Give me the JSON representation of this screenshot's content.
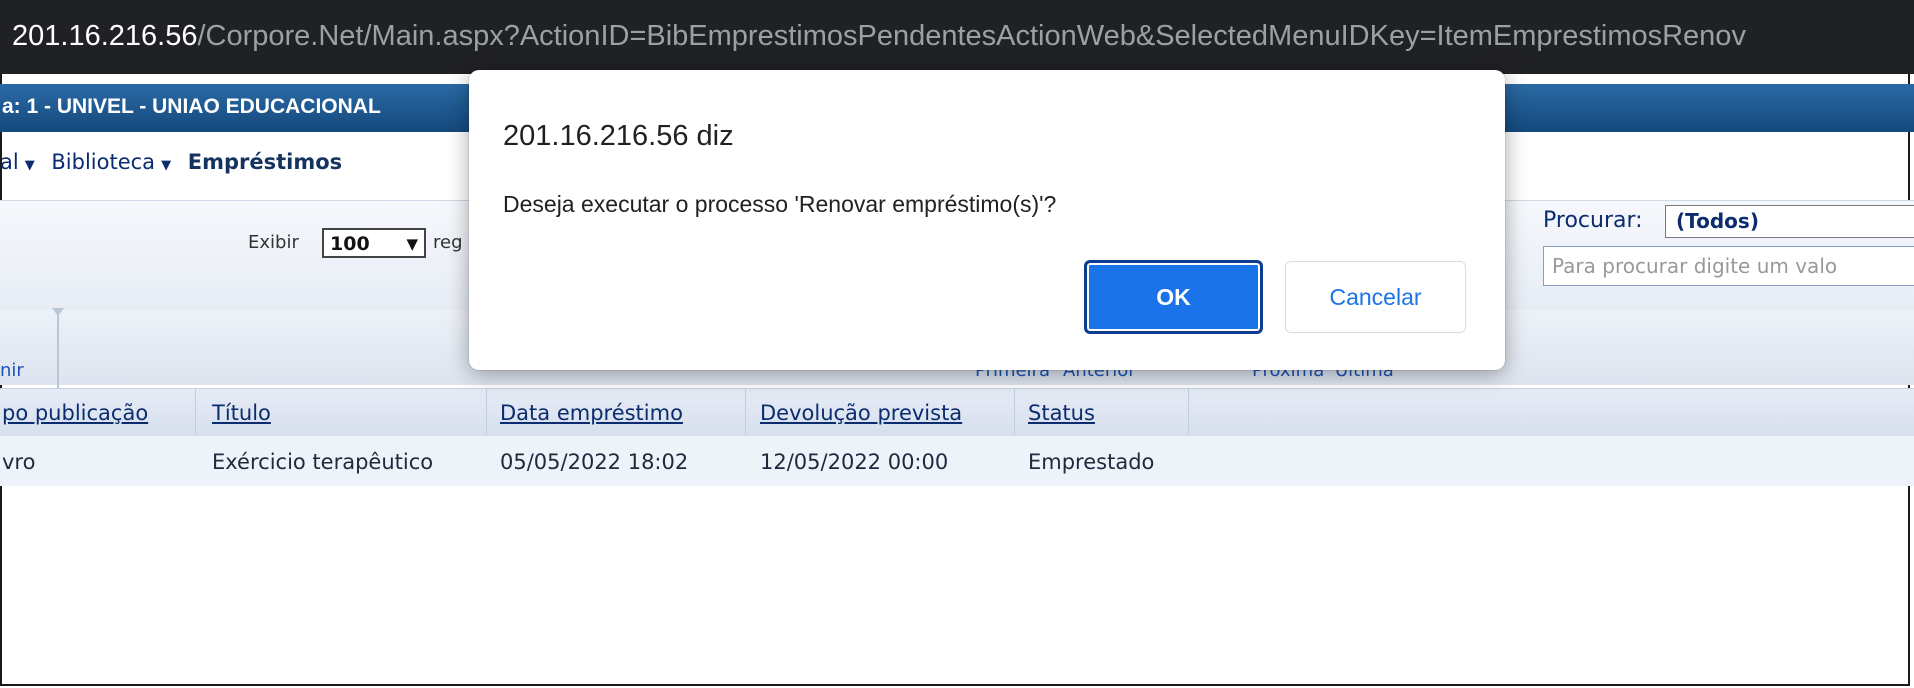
{
  "browser": {
    "url_host": "201.16.216.56",
    "url_path": "/Corpore.Net/Main.aspx?ActionID=BibEmprestimosPendentesActionWeb&SelectedMenuIDKey=ItemEmprestimosRenov"
  },
  "titlebar": {
    "text": "a: 1 - UNIVEL - UNIAO EDUCACIONAL"
  },
  "breadcrumb": {
    "item1": "al",
    "item2": "Biblioteca",
    "current": "Empréstimos"
  },
  "toolbar": {
    "exibir_label": "Exibir",
    "exibir_value": "100",
    "registros_label": "reg",
    "procurar_label": "Procurar:",
    "procurar_value": "(Todos)",
    "search_placeholder": "Para procurar digite um valo"
  },
  "nav": {
    "imprimir": "nir",
    "primeira": "Primeira",
    "anterior": "Anterior",
    "proxima": "Próxima",
    "ultima": "Última"
  },
  "table": {
    "headers": [
      "po publicação",
      "Título",
      "Data empréstimo",
      "Devolução prevista",
      "Status"
    ],
    "rows": [
      [
        "vro",
        "Exércicio terapêutico",
        "05/05/2022 18:02",
        "12/05/2022 00:00",
        "Emprestado"
      ]
    ]
  },
  "dialog": {
    "title": "201.16.216.56 diz",
    "message": "Deseja executar o processo 'Renovar empréstimo(s)'?",
    "ok_label": "OK",
    "cancel_label": "Cancelar"
  },
  "colors": {
    "accent": "#1a73e8",
    "titlebar": "#14497d",
    "link": "#0b2c6e"
  }
}
